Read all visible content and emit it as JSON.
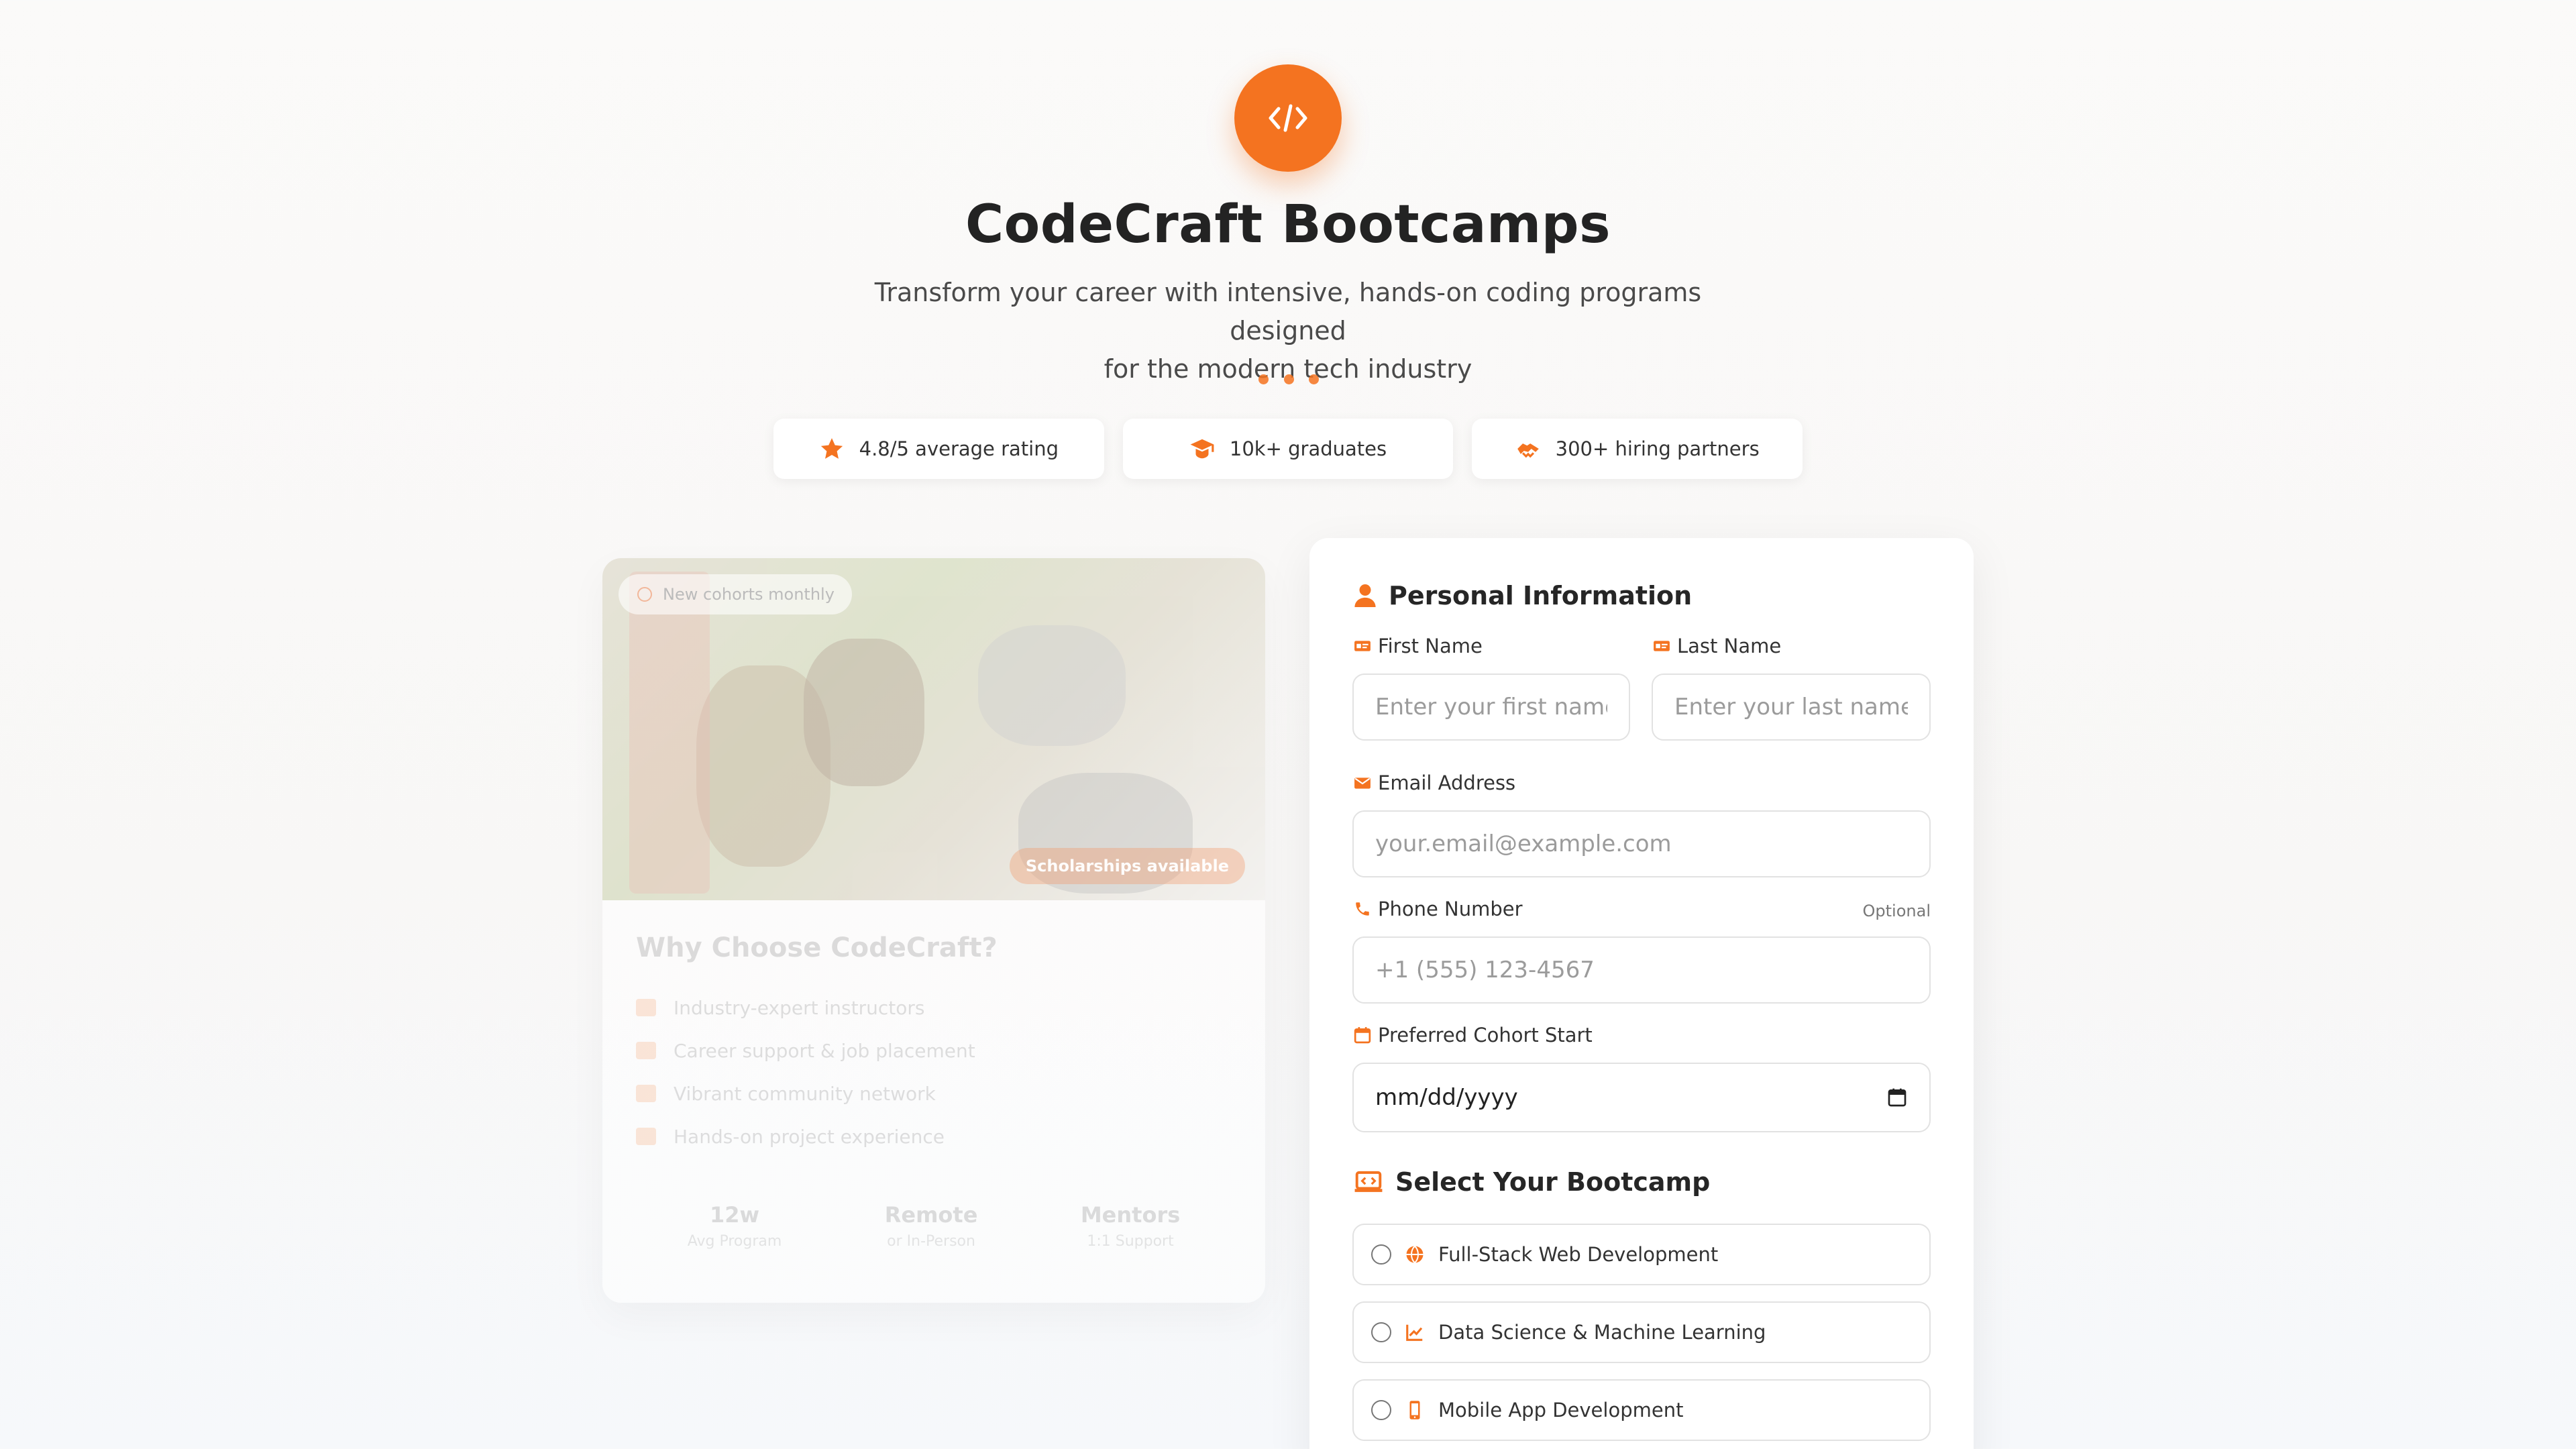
{
  "header": {
    "title": "CodeCraft Bootcamps",
    "subtitle_line1": "Transform your career with intensive, hands-on coding programs designed",
    "subtitle_line2": "for the modern tech industry",
    "logo_icon": "code-icon"
  },
  "stats": [
    {
      "icon": "star-icon",
      "label": "4.8/5 average rating"
    },
    {
      "icon": "graduate-icon",
      "label": "10k+ graduates"
    },
    {
      "icon": "handshake-icon",
      "label": "300+ hiring partners"
    }
  ],
  "promo": {
    "badge_top": "New cohorts monthly",
    "badge_bottom": "Scholarships available",
    "title": "Why Choose CodeCraft?",
    "features": [
      "Industry-expert instructors",
      "Career support & job placement",
      "Vibrant community network",
      "Hands-on project experience"
    ],
    "metrics": [
      {
        "value": "12w",
        "label": "Avg Program"
      },
      {
        "value": "Remote",
        "label": "or In-Person"
      },
      {
        "value": "Mentors",
        "label": "1:1 Support"
      }
    ]
  },
  "form": {
    "personal_title": "Personal Information",
    "first_name_label": "First Name",
    "first_name_placeholder": "Enter your first name",
    "last_name_label": "Last Name",
    "last_name_placeholder": "Enter your last name",
    "email_label": "Email Address",
    "email_placeholder": "your.email@example.com",
    "phone_label": "Phone Number",
    "phone_optional": "Optional",
    "phone_placeholder": "+1 (555) 123-4567",
    "cohort_label": "Preferred Cohort Start",
    "cohort_value": "mm/dd/yyyy",
    "bootcamp_title": "Select Your Bootcamp",
    "bootcamps": [
      {
        "icon": "globe-icon",
        "label": "Full-Stack Web Development"
      },
      {
        "icon": "chart-line-icon",
        "label": "Data Science & Machine Learning"
      },
      {
        "icon": "mobile-icon",
        "label": "Mobile App Development"
      }
    ]
  },
  "colors": {
    "accent": "#f47320",
    "text": "#232323",
    "border": "#e2e2e2"
  }
}
